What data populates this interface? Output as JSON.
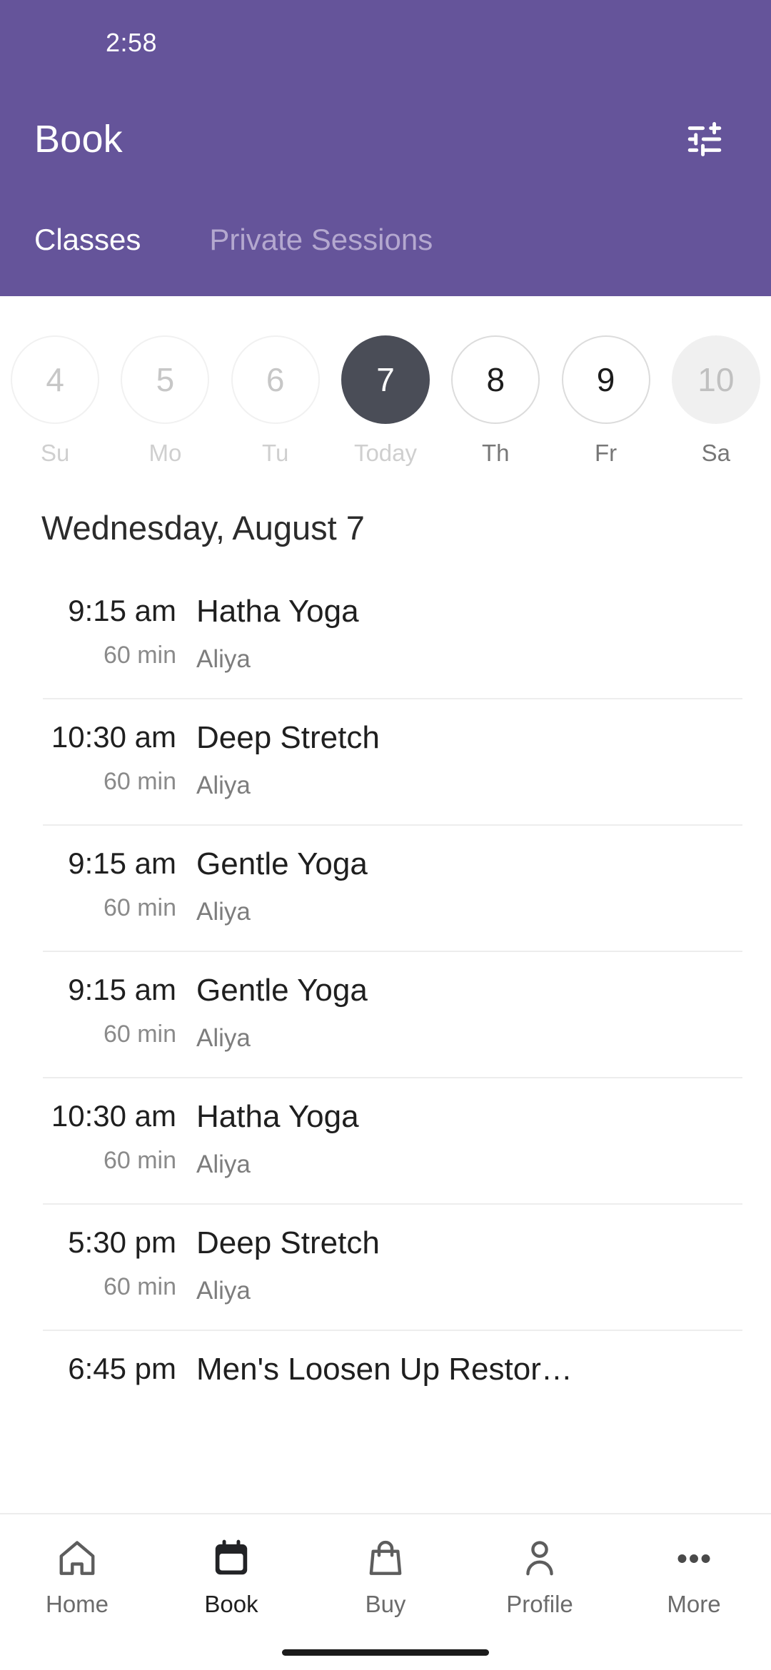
{
  "status_bar": {
    "time": "2:58"
  },
  "header": {
    "title": "Book",
    "filter_icon": "tune-filter-icon",
    "background_color": "#65549A",
    "tabs": [
      {
        "label": "Classes",
        "active": true
      },
      {
        "label": "Private Sessions",
        "active": false
      }
    ]
  },
  "date_strip": {
    "selected_color": "#4A4D57",
    "days": [
      {
        "number": "4",
        "label": "Su",
        "state": "past"
      },
      {
        "number": "5",
        "label": "Mo",
        "state": "past"
      },
      {
        "number": "6",
        "label": "Tu",
        "state": "past"
      },
      {
        "number": "7",
        "label": "Today",
        "state": "selected"
      },
      {
        "number": "8",
        "label": "Th",
        "state": "future"
      },
      {
        "number": "9",
        "label": "Fr",
        "state": "future"
      },
      {
        "number": "10",
        "label": "Sa",
        "state": "filled"
      }
    ]
  },
  "day_heading": "Wednesday, August 7",
  "classes": [
    {
      "time": "9:15 am",
      "duration": "60 min",
      "name": "Hatha Yoga",
      "teacher": "Aliya"
    },
    {
      "time": "10:30 am",
      "duration": "60 min",
      "name": "Deep Stretch",
      "teacher": "Aliya"
    },
    {
      "time": "9:15 am",
      "duration": "60 min",
      "name": "Gentle Yoga",
      "teacher": "Aliya"
    },
    {
      "time": "9:15 am",
      "duration": "60 min",
      "name": "Gentle Yoga",
      "teacher": "Aliya"
    },
    {
      "time": "10:30 am",
      "duration": "60 min",
      "name": "Hatha Yoga",
      "teacher": "Aliya"
    },
    {
      "time": "5:30 pm",
      "duration": "60 min",
      "name": "Deep Stretch",
      "teacher": "Aliya"
    },
    {
      "time": "6:45 pm",
      "duration": "",
      "name": "Men's Loosen Up Restor…",
      "teacher": ""
    }
  ],
  "bottom_nav": {
    "items": [
      {
        "label": "Home",
        "icon": "home-icon",
        "active": false
      },
      {
        "label": "Book",
        "icon": "calendar-icon",
        "active": true
      },
      {
        "label": "Buy",
        "icon": "bag-icon",
        "active": false
      },
      {
        "label": "Profile",
        "icon": "person-icon",
        "active": false
      },
      {
        "label": "More",
        "icon": "dots-icon",
        "active": false
      }
    ]
  }
}
